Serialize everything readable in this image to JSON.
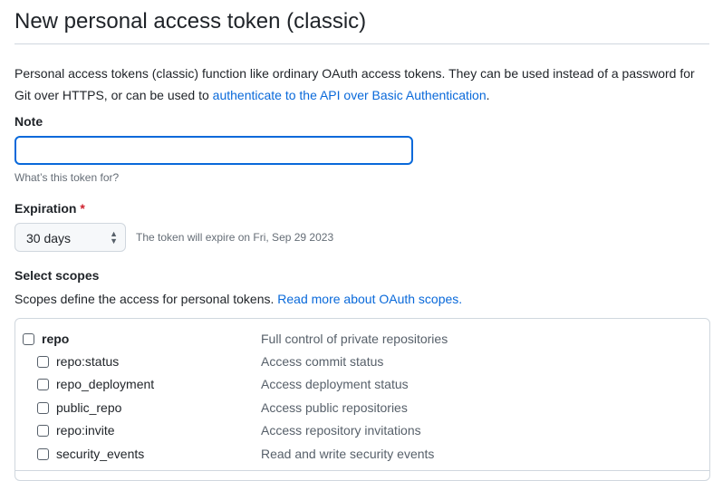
{
  "title": "New personal access token (classic)",
  "intro": {
    "text": "Personal access tokens (classic) function like ordinary OAuth access tokens. They can be used instead of a password for Git over HTTPS, or can be used to ",
    "link": "authenticate to the API over Basic Authentication",
    "end": "."
  },
  "note": {
    "label": "Note",
    "value": "",
    "hint": "What’s this token for?"
  },
  "expiration": {
    "label": "Expiration",
    "required": "*",
    "selected": "30 days",
    "info": "The token will expire on Fri, Sep 29 2023"
  },
  "scopes": {
    "label": "Select scopes",
    "text": "Scopes define the access for personal tokens. ",
    "link": "Read more about OAuth scopes.",
    "items": [
      {
        "name": "repo",
        "desc": "Full control of private repositories"
      },
      {
        "name": "repo:status",
        "desc": "Access commit status"
      },
      {
        "name": "repo_deployment",
        "desc": "Access deployment status"
      },
      {
        "name": "public_repo",
        "desc": "Access public repositories"
      },
      {
        "name": "repo:invite",
        "desc": "Access repository invitations"
      },
      {
        "name": "security_events",
        "desc": "Read and write security events"
      }
    ]
  }
}
